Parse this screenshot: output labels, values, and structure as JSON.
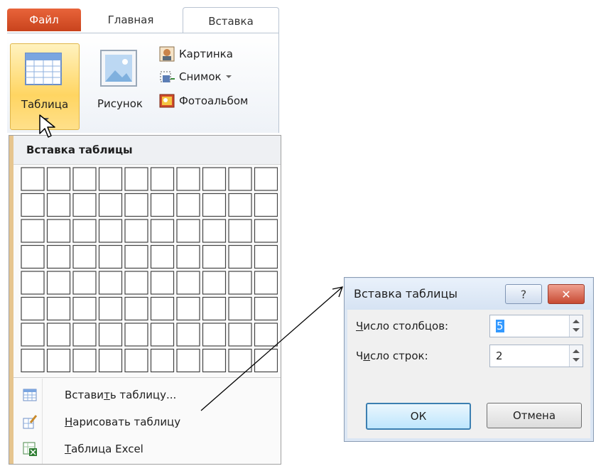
{
  "ribbon": {
    "tabs": [
      {
        "label": "Файл"
      },
      {
        "label": "Главная"
      },
      {
        "label": "Вставка"
      }
    ],
    "buttons": {
      "table": "Таблица",
      "picture": "Рисунок",
      "clipart": "Картинка",
      "screenshot": "Снимок",
      "photoalbum": "Фотоальбом"
    }
  },
  "menu": {
    "header": "Вставка таблицы",
    "grid": {
      "columns": 10,
      "rows": 8
    },
    "items": [
      {
        "pre": "Встави",
        "u": "т",
        "post": "ь таблицу..."
      },
      {
        "pre": "",
        "u": "Н",
        "post": "арисовать таблицу"
      },
      {
        "pre": "",
        "u": "Т",
        "post": "аблица Excel"
      }
    ]
  },
  "dialog": {
    "title": "Вставка таблицы",
    "help": "?",
    "close": "✕",
    "columns_label": {
      "u": "Ч",
      "post": "исло столбцов:"
    },
    "columns_value": "5",
    "rows_label": {
      "pre": "Ч",
      "u": "и",
      "post": "сло строк:"
    },
    "rows_value": "2",
    "ok": "ОК",
    "cancel": "Отмена"
  }
}
